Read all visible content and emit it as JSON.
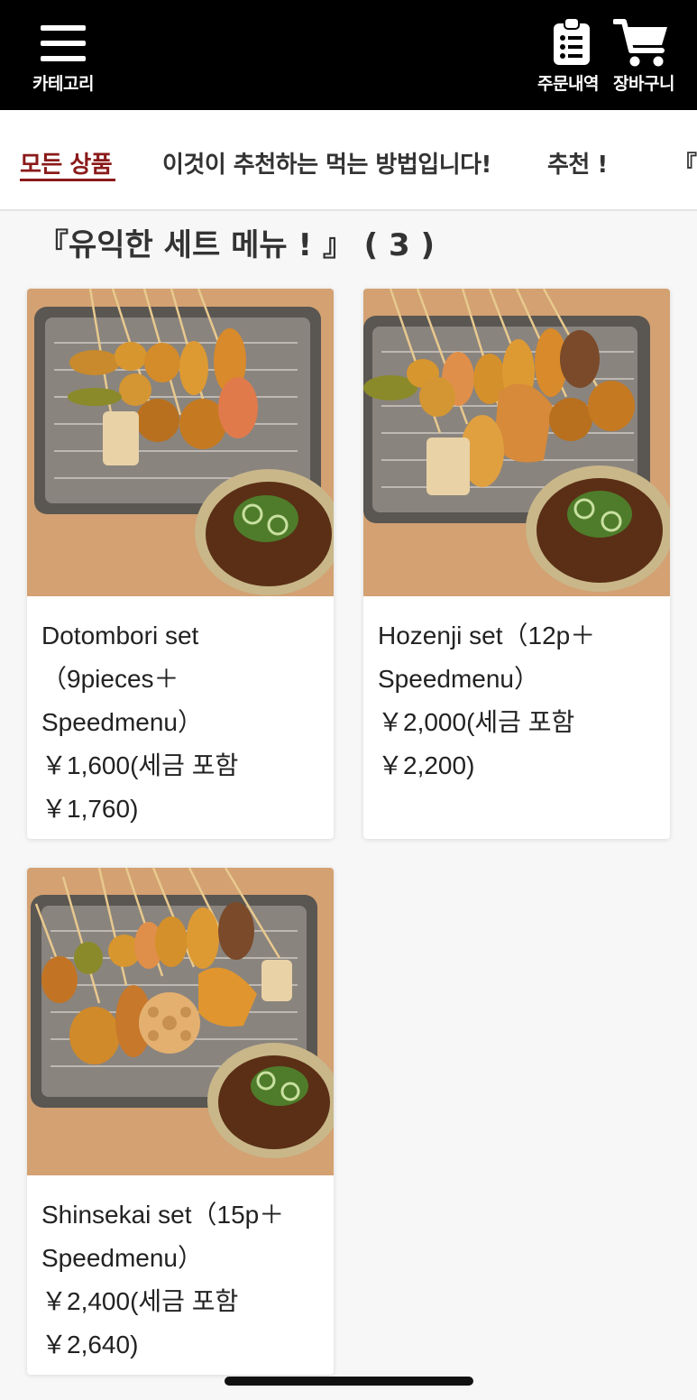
{
  "header": {
    "category_label": "카테고리",
    "order_history_label": "주문내역",
    "cart_label": "장바구니"
  },
  "tabs": [
    {
      "label": "모든 상품",
      "active": true
    },
    {
      "label": "이것이 추천하는 먹는 방법입니다!"
    },
    {
      "label": "추천 !"
    },
    {
      "label": "『유"
    }
  ],
  "section": {
    "title": "『유익한 세트 메뉴 ! 』 ( 3 )"
  },
  "products": [
    {
      "name_lines": [
        "Dotombori set",
        "（9pieces＋",
        "Speedmenu）"
      ],
      "price_line": "￥1,600(세금 포함",
      "price_tax_line": "￥1,760)"
    },
    {
      "name_lines": [
        "Hozenji set（12p＋",
        "Speedmenu）"
      ],
      "price_line": "￥2,000(세금 포함",
      "price_tax_line": "￥2,200)"
    },
    {
      "name_lines": [
        "Shinsekai set（15p＋",
        "Speedmenu）"
      ],
      "price_line": "￥2,400(세금 포함",
      "price_tax_line": "￥2,640)"
    }
  ],
  "colors": {
    "header_bg": "#000000",
    "accent": "#8b1a1a"
  },
  "icons": {
    "category": "hamburger-menu-icon",
    "orders": "clipboard-list-icon",
    "cart": "shopping-cart-icon"
  }
}
